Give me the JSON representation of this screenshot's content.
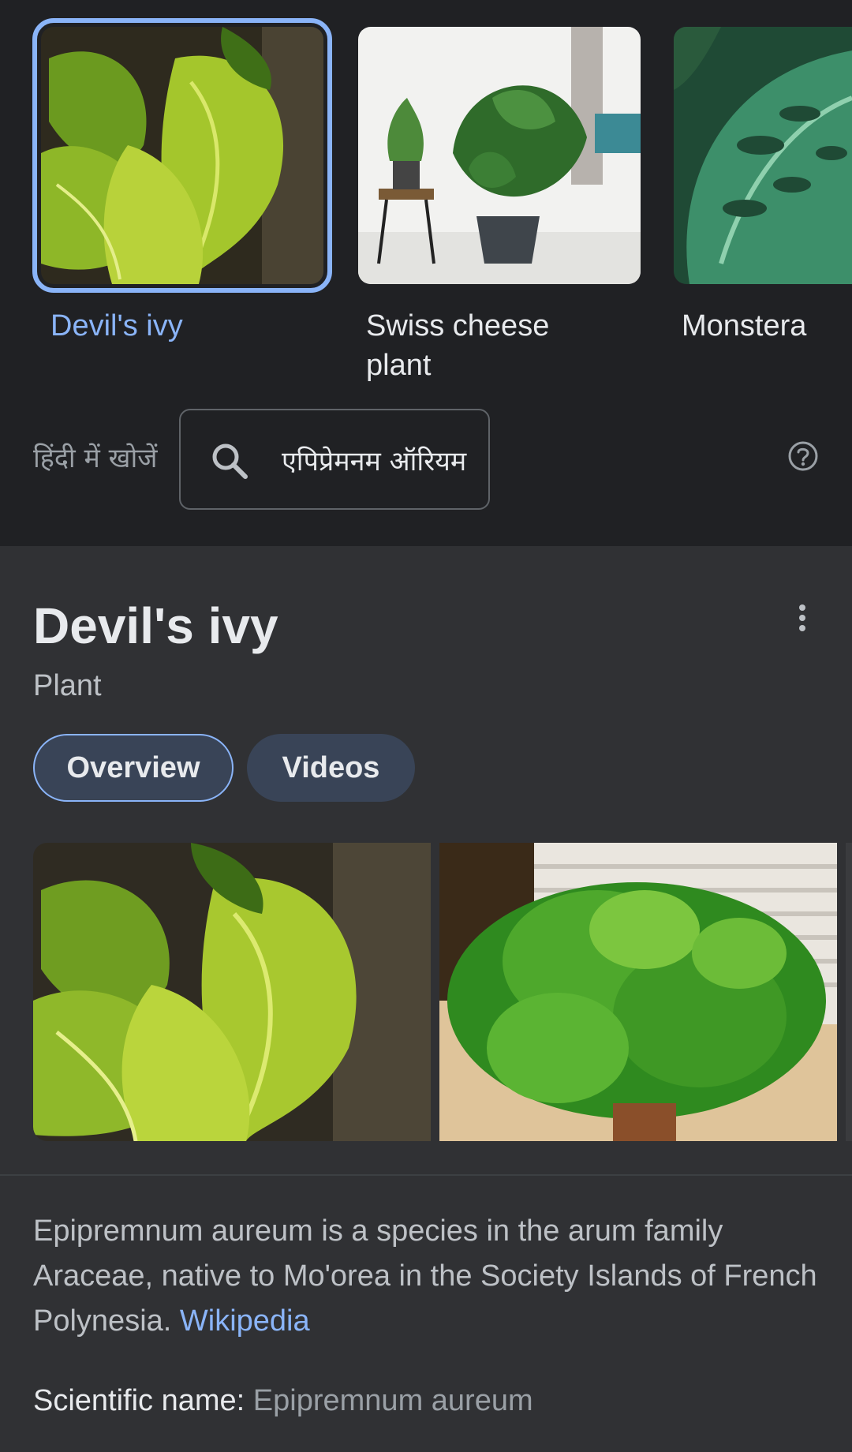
{
  "carousel": {
    "items": [
      {
        "label": "Devil's ivy",
        "selected": true
      },
      {
        "label": "Swiss cheese plant",
        "selected": false
      },
      {
        "label": "Monstera",
        "selected": false
      }
    ]
  },
  "hindi_search": {
    "label": "हिंदी में खोजें",
    "query": "एपिप्रेमनम ऑरियम",
    "search_icon": "search-icon",
    "help_icon": "help-icon"
  },
  "knowledge_panel": {
    "title": "Devil's ivy",
    "subtitle": "Plant",
    "tabs": [
      {
        "label": "Overview",
        "active": true
      },
      {
        "label": "Videos",
        "active": false
      }
    ],
    "description": "Epipremnum aureum is a species in the arum family Araceae, native to Mo'orea in the Society Islands of French Polynesia.",
    "source_link": "Wikipedia",
    "scientific_name_label": "Scientific name:",
    "scientific_name_value": "Epipremnum aureum"
  },
  "colors": {
    "background": "#202124",
    "panel": "#303134",
    "accent": "#8ab4f8",
    "tab_bg": "#394457"
  }
}
